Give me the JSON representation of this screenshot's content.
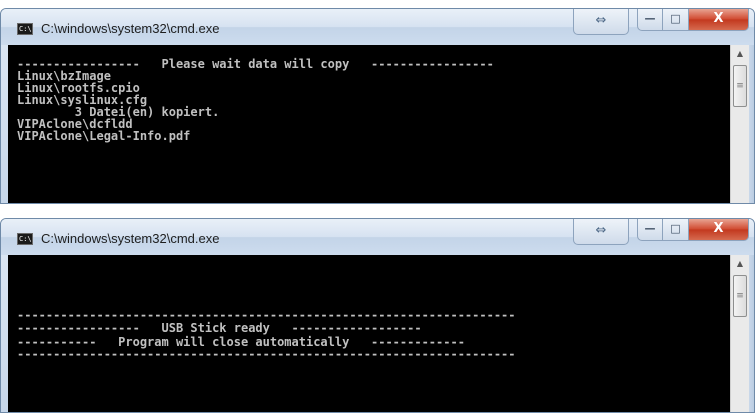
{
  "windows": [
    {
      "title": "C:\\windows\\system32\\cmd.exe",
      "icon": "cmd-icon",
      "icon_text": "C:\\",
      "buttons": {
        "snap": "⇔",
        "minimize": "—",
        "maximize": "□",
        "close": "X"
      },
      "console_lines": [
        "-----------------   Please wait data will copy   -----------------",
        "Linux\\bzImage",
        "Linux\\rootfs.cpio",
        "Linux\\syslinux.cfg",
        "        3 Datei(en) kopiert.",
        "VIPAclone\\dcfldd",
        "VIPAclone\\Legal-Info.pdf"
      ],
      "scrollbar": {
        "up_arrow": "▲",
        "thumb_grip": "≡"
      }
    },
    {
      "title": "C:\\windows\\system32\\cmd.exe",
      "icon": "cmd-icon",
      "icon_text": "C:\\",
      "buttons": {
        "snap": "⇔",
        "minimize": "—",
        "maximize": "□",
        "close": "X"
      },
      "console_lines": [
        "---------------------------------------------------------------------",
        "-----------------   USB Stick ready   ------------------",
        "-----------   Program will close automatically   -------------",
        "---------------------------------------------------------------------"
      ],
      "scrollbar": {
        "up_arrow": "▲",
        "thumb_grip": "≡"
      }
    }
  ],
  "colors": {
    "console_background": "#000000",
    "console_text": "#c0c0c0",
    "close_button": "#c2381e",
    "titlebar": "#d6e2f1"
  }
}
